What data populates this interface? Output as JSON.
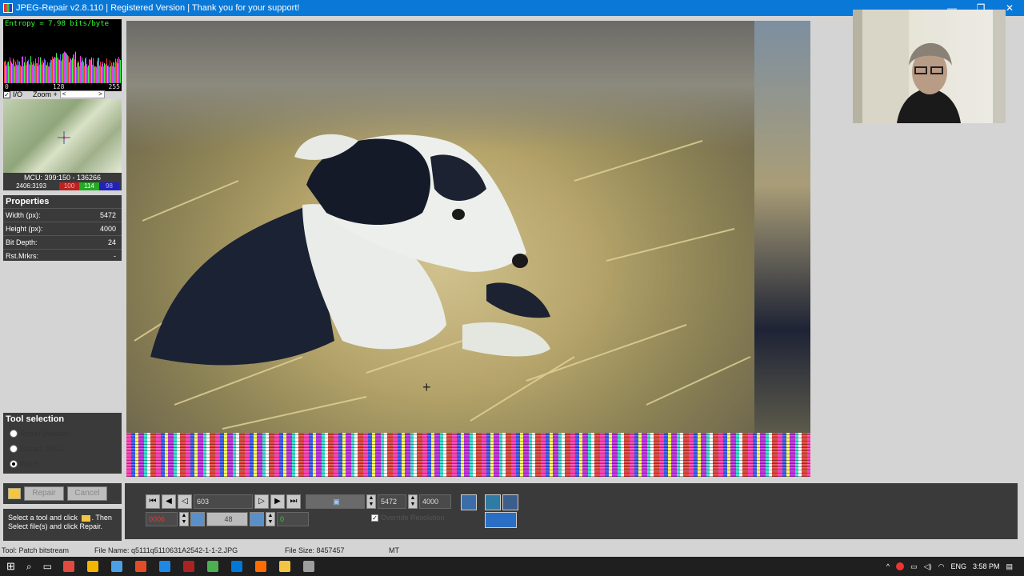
{
  "window": {
    "title": "JPEG-Repair v2.8.110 | Registered Version | Thank you for your support!",
    "minimize": "—",
    "restore": "❐",
    "close": "✕"
  },
  "histogram": {
    "entropy_label": "Entropy = 7.98 bits/byte",
    "axis_min": "0",
    "axis_mid": "128",
    "axis_max": "255"
  },
  "zoom": {
    "io_label": "I/O",
    "io_checked": "✓",
    "zoom_label": "Zoom +",
    "left_arrow": "<",
    "right_arrow": ">"
  },
  "mcu": {
    "label": "MCU: 399:150 - 136266",
    "position": "2406:3193",
    "r": "100",
    "g": "114",
    "b": "98"
  },
  "properties": {
    "header": "Properties",
    "rows": [
      {
        "label": "Width (px):",
        "value": "5472"
      },
      {
        "label": "Height (px):",
        "value": "4000"
      },
      {
        "label": "Bit Depth:",
        "value": "24"
      },
      {
        "label": "Rst.Mrkrs:",
        "value": "-"
      }
    ]
  },
  "tool_selection": {
    "header": "Tool selection",
    "options": [
      "Repair (header)",
      "Extract JPEG",
      "Patch"
    ],
    "selected": "Patch"
  },
  "actions": {
    "repair_label": "Repair",
    "cancel_label": "Cancel"
  },
  "hint": {
    "line1": "Select a tool and click",
    "line1b": ". Then",
    "line2": "Select file(s) and click Repair."
  },
  "controls": {
    "offset_value": "603",
    "width_value": "5472",
    "height_value": "4000",
    "red_value": "0006",
    "slider_value": "48",
    "green_value": "0",
    "override_label": "Override Resolution",
    "override_checked": "✓",
    "first": "⏮",
    "prev": "◀",
    "stepback": "◁",
    "stepfwd": "▷",
    "next": "▶",
    "last": "⏭"
  },
  "statusbar": {
    "tool": "Tool: Patch bitstream",
    "filename": "File Name: q5111q5110631A2542-1-1-2.JPG",
    "filesize": "File Size: 8457457",
    "mode": "MT"
  },
  "taskbar": {
    "lang": "ENG",
    "time": "3:58 PM",
    "colors": [
      "#e04a3f",
      "#f4b400",
      "#4b9fe6",
      "#e34c26",
      "#1e88e5",
      "#aa2222",
      "#4caf50",
      "#0078d7",
      "#ff6d00",
      "#f4c542",
      "#9e9e9e"
    ]
  },
  "colors": {
    "titlebar": "#0a78d7",
    "panel": "#3a3a3a",
    "background": "#d4d4d4"
  }
}
